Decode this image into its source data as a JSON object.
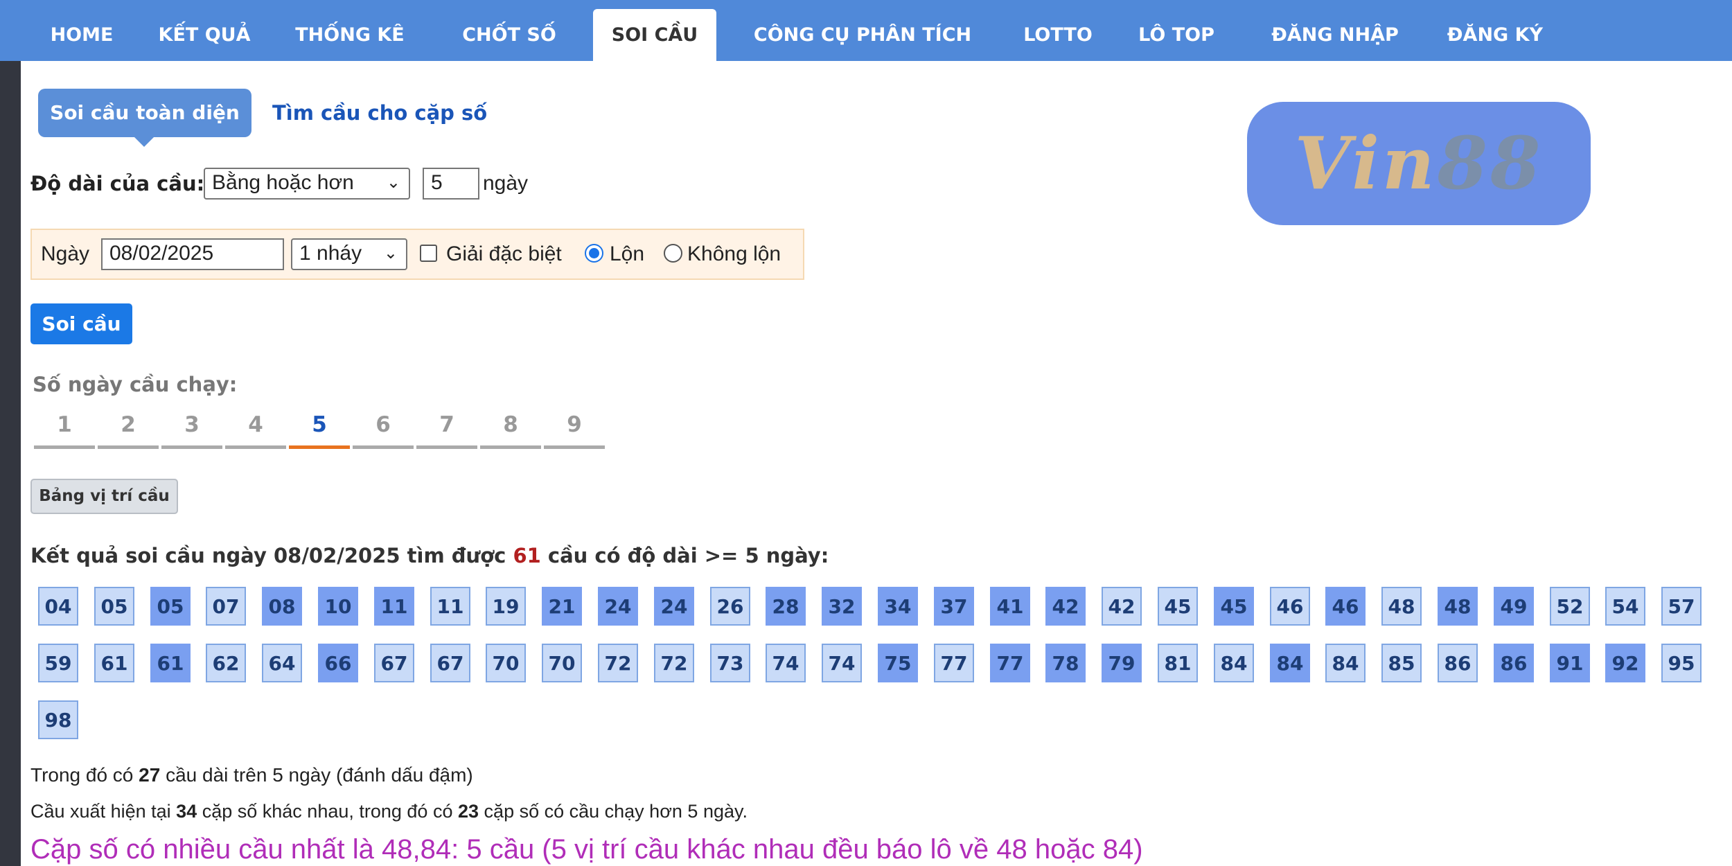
{
  "nav": {
    "items": [
      {
        "label": "HOME",
        "active": false
      },
      {
        "label": "KẾT QUẢ",
        "active": false
      },
      {
        "label": "THỐNG KÊ",
        "active": false
      },
      {
        "label": "CHỐT SỐ",
        "active": false
      },
      {
        "label": "SOI CẦU",
        "active": true
      },
      {
        "label": "CÔNG CỤ PHÂN TÍCH",
        "active": false
      },
      {
        "label": "LOTTO",
        "active": false
      },
      {
        "label": "LÔ TOP",
        "active": false
      },
      {
        "label": "ĐĂNG NHẬP",
        "active": false
      },
      {
        "label": "ĐĂNG KÝ",
        "active": false
      }
    ]
  },
  "subtabs": {
    "active": "Soi cầu toàn diện",
    "other": "Tìm cầu cho cặp số"
  },
  "length": {
    "label": "Độ dài của cầu:",
    "mode": "Bằng hoặc hơn",
    "value": "5",
    "unit": "ngày"
  },
  "filter": {
    "date_label": "Ngày",
    "date_value": "08/02/2025",
    "nhay": "1 nháy",
    "special_label": "Giải đặc biệt",
    "special_checked": false,
    "lon_label": "Lộn",
    "khong_lon_label": "Không lộn",
    "selected": "Lộn"
  },
  "soi_button": "Soi cầu",
  "days": {
    "label": "Số ngày cầu chạy:",
    "values": [
      "1",
      "2",
      "3",
      "4",
      "5",
      "6",
      "7",
      "8",
      "9"
    ],
    "active": "5"
  },
  "table_button": "Bảng vị trí cầu",
  "result": {
    "prefix": "Kết quả soi cầu ngày 08/02/2025 tìm được",
    "count": "61",
    "suffix": "cầu có độ dài >= 5 ngày:"
  },
  "numbers": [
    {
      "v": "04",
      "d": false
    },
    {
      "v": "05",
      "d": false
    },
    {
      "v": "05",
      "d": true
    },
    {
      "v": "07",
      "d": false
    },
    {
      "v": "08",
      "d": true
    },
    {
      "v": "10",
      "d": true
    },
    {
      "v": "11",
      "d": true
    },
    {
      "v": "11",
      "d": false
    },
    {
      "v": "19",
      "d": false
    },
    {
      "v": "21",
      "d": true
    },
    {
      "v": "24",
      "d": true
    },
    {
      "v": "24",
      "d": true
    },
    {
      "v": "26",
      "d": false
    },
    {
      "v": "28",
      "d": true
    },
    {
      "v": "32",
      "d": true
    },
    {
      "v": "34",
      "d": true
    },
    {
      "v": "37",
      "d": true
    },
    {
      "v": "41",
      "d": true
    },
    {
      "v": "42",
      "d": true
    },
    {
      "v": "42",
      "d": false
    },
    {
      "v": "45",
      "d": false
    },
    {
      "v": "45",
      "d": true
    },
    {
      "v": "46",
      "d": false
    },
    {
      "v": "46",
      "d": true
    },
    {
      "v": "48",
      "d": false
    },
    {
      "v": "48",
      "d": true
    },
    {
      "v": "49",
      "d": true
    },
    {
      "v": "52",
      "d": false
    },
    {
      "v": "54",
      "d": false
    },
    {
      "v": "57",
      "d": false
    },
    {
      "v": "59",
      "d": false
    },
    {
      "v": "61",
      "d": false
    },
    {
      "v": "61",
      "d": true
    },
    {
      "v": "62",
      "d": false
    },
    {
      "v": "64",
      "d": false
    },
    {
      "v": "66",
      "d": true
    },
    {
      "v": "67",
      "d": false
    },
    {
      "v": "67",
      "d": false
    },
    {
      "v": "70",
      "d": false
    },
    {
      "v": "70",
      "d": false
    },
    {
      "v": "72",
      "d": false
    },
    {
      "v": "72",
      "d": false
    },
    {
      "v": "73",
      "d": false
    },
    {
      "v": "74",
      "d": false
    },
    {
      "v": "74",
      "d": false
    },
    {
      "v": "75",
      "d": true
    },
    {
      "v": "77",
      "d": false
    },
    {
      "v": "77",
      "d": true
    },
    {
      "v": "78",
      "d": true
    },
    {
      "v": "79",
      "d": true
    },
    {
      "v": "81",
      "d": false
    },
    {
      "v": "84",
      "d": false
    },
    {
      "v": "84",
      "d": true
    },
    {
      "v": "84",
      "d": false
    },
    {
      "v": "85",
      "d": false
    },
    {
      "v": "86",
      "d": false
    },
    {
      "v": "86",
      "d": true
    },
    {
      "v": "91",
      "d": true
    },
    {
      "v": "92",
      "d": true
    },
    {
      "v": "95",
      "d": false
    },
    {
      "v": "98",
      "d": false
    }
  ],
  "notes": {
    "line1_prefix": "Trong đó có",
    "line1_count": "27",
    "line1_suffix": "cầu dài trên 5 ngày (đánh dấu đậm)",
    "line2_prefix": "Cầu xuất hiện tại",
    "line2_count1": "34",
    "line2_mid": "cặp số khác nhau, trong đó có",
    "line2_count2": "23",
    "line2_suffix": "cặp số có cầu chạy hơn 5 ngày.",
    "highlight": "Cặp số có nhiều cầu nhất là 48,84: 5 cầu (5 vị trí cầu khác nhau đều báo lô về 48 hoặc 84)"
  },
  "logo": {
    "text_a": "Vin",
    "text_b": "88"
  },
  "colors": {
    "nav_bg": "#5089d9",
    "accent": "#1b79e6",
    "tab_underline": "#e8731f",
    "highlight": "#b02db8"
  }
}
